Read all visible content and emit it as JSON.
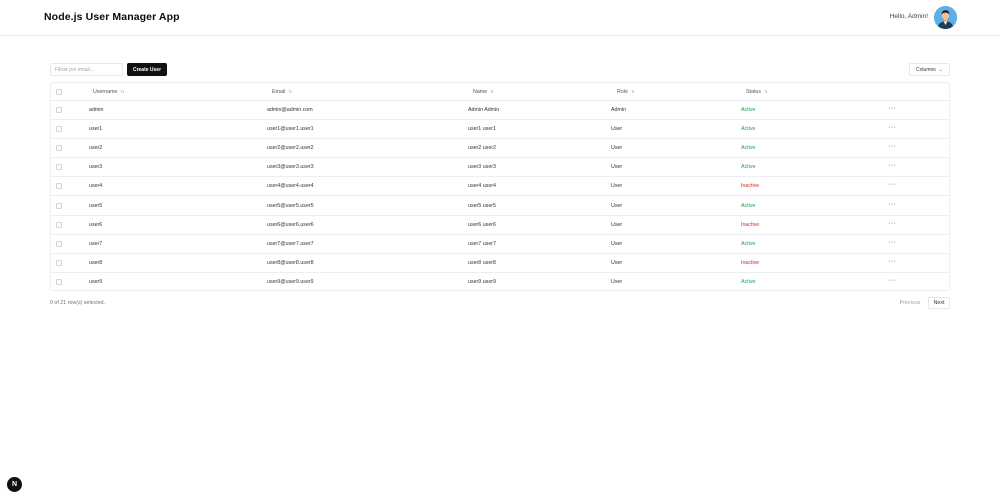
{
  "header": {
    "title": "Node.js User Manager App",
    "greeting": "Hello, Admin!",
    "avatar_icon": "user-avatar"
  },
  "toolbar": {
    "filter_placeholder": "Filtrar por email...",
    "create_label": "Create User",
    "columns_label": "Columns"
  },
  "table": {
    "headers": {
      "username": "Username",
      "email": "Email",
      "name": "Name",
      "role": "Role",
      "status": "Status"
    },
    "rows": [
      {
        "username": "admin",
        "email": "admin@admin.com",
        "name": "Admin Admin",
        "role": "Admin",
        "status": "Active"
      },
      {
        "username": "user1",
        "email": "user1@user1.user1",
        "name": "user1 user1",
        "role": "User",
        "status": "Active"
      },
      {
        "username": "user2",
        "email": "user2@user2.user2",
        "name": "user2 user2",
        "role": "User",
        "status": "Active"
      },
      {
        "username": "user3",
        "email": "user3@user3.user3",
        "name": "user3 user3",
        "role": "User",
        "status": "Active"
      },
      {
        "username": "user4",
        "email": "user4@user4.user4",
        "name": "user4 user4",
        "role": "User",
        "status": "Inactive"
      },
      {
        "username": "user5",
        "email": "user5@user5.user5",
        "name": "user5 user5",
        "role": "User",
        "status": "Active"
      },
      {
        "username": "user6",
        "email": "user6@user6.user6",
        "name": "user6 user6",
        "role": "User",
        "status": "Inactive"
      },
      {
        "username": "user7",
        "email": "user7@user7.user7",
        "name": "user7 user7",
        "role": "User",
        "status": "Active"
      },
      {
        "username": "user8",
        "email": "user8@user8.user8",
        "name": "user8 user8",
        "role": "User",
        "status": "Inactive"
      },
      {
        "username": "user9",
        "email": "user9@user9.user9",
        "name": "user9 user9",
        "role": "User",
        "status": "Active"
      }
    ]
  },
  "footer": {
    "selected_text": "0 of 21 row(s) selected.",
    "previous_label": "Previous",
    "next_label": "Next"
  },
  "badge": {
    "letter": "N"
  },
  "colors": {
    "active": "#16a34a",
    "inactive": "#dc2626",
    "primary_button": "#111111"
  }
}
